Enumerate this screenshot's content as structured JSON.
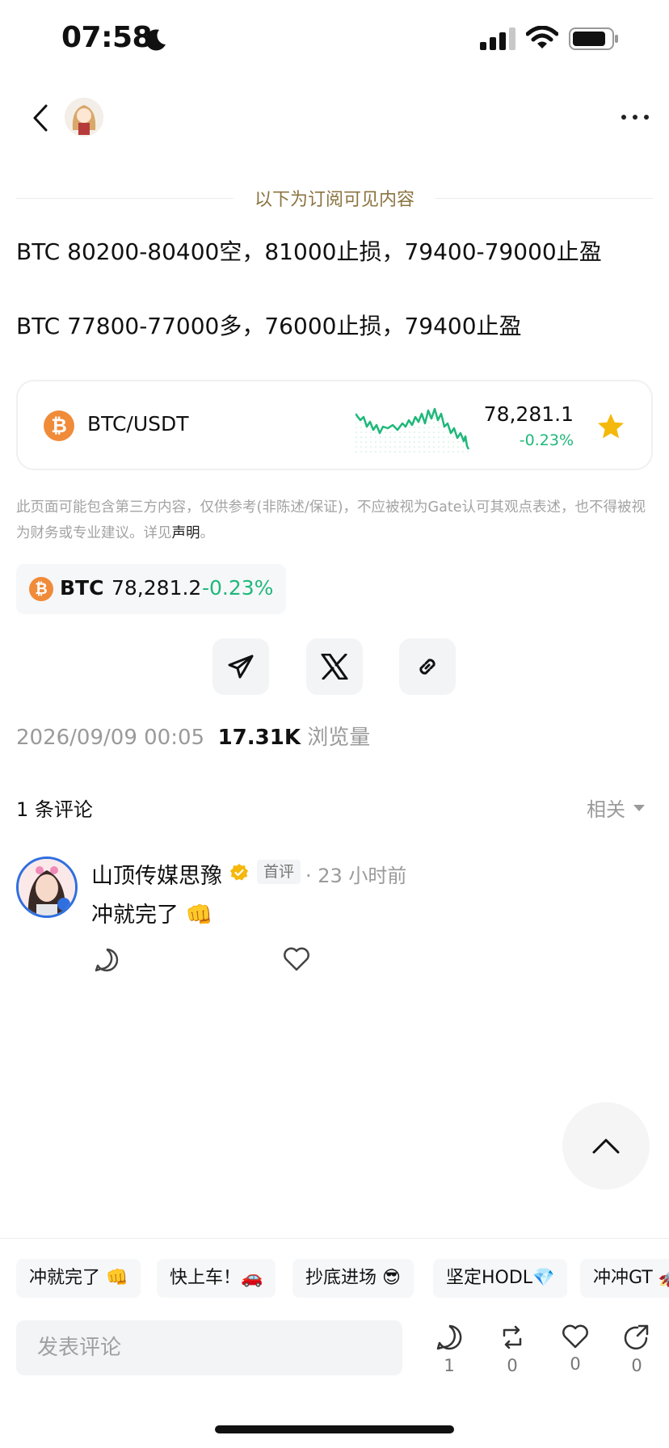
{
  "status_bar": {
    "time": "07:58"
  },
  "nav": {},
  "subscription_label": "以下为订阅可见内容",
  "post": {
    "lines": [
      "BTC 80200-80400空，81000止损，79400-79000止盈",
      "BTC  77800-77000多，76000止损，79400止盈"
    ]
  },
  "market_card": {
    "pair": "BTC/USDT",
    "price": "78,281.1",
    "change": "-0.23%",
    "change_color": "#1fb87a",
    "coin_color": "#f08b3a",
    "favorite": true
  },
  "disclaimer": {
    "text": "此页面可能包含第三方内容，仅供参考(非陈述/保证)，不应被视为Gate认可其观点表述，也不得被视为财务或专业建议。详见",
    "link": "声明",
    "suffix": "。"
  },
  "ticker": {
    "symbol": "BTC",
    "price": "78,281.2",
    "change": "-0.23%"
  },
  "share": {
    "icons": [
      "telegram-icon",
      "x-icon",
      "link-icon"
    ]
  },
  "meta": {
    "date": "2026/09/09 00:05",
    "views": "17.31K",
    "views_label": "浏览量"
  },
  "comments": {
    "count_label": "1 条评论",
    "sort_label": "相关",
    "items": [
      {
        "author": "山顶传媒思豫",
        "tag": "首评",
        "time": "· 23 小时前",
        "text": "冲就完了 👊"
      }
    ]
  },
  "quick_replies": [
    "冲就完了 👊",
    "快上车！🚗",
    "抄底进场 😎",
    "坚定HODL💎",
    "冲冲GT 🚀"
  ],
  "composer": {
    "placeholder": "发表评论"
  },
  "actions": {
    "comments": "1",
    "reposts": "0",
    "likes": "0",
    "shares": "0"
  }
}
